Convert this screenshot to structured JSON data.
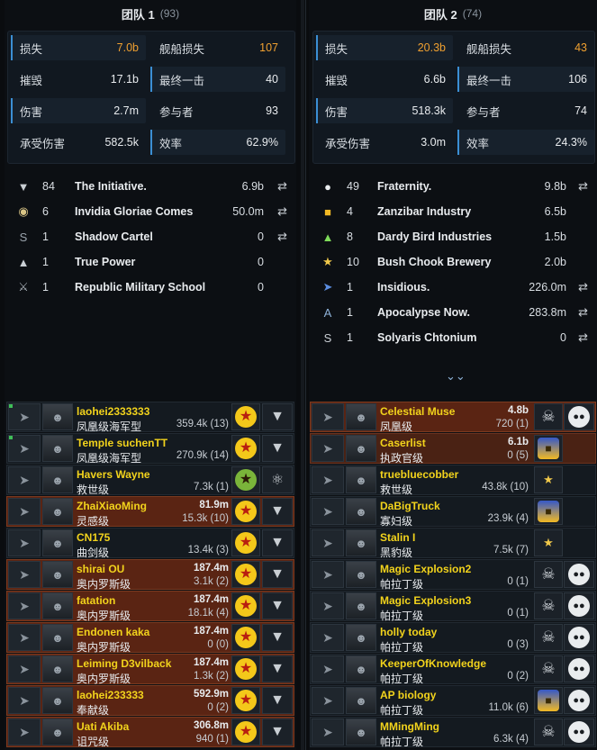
{
  "team1": {
    "name": "团队 1",
    "count": "(93)",
    "stats": [
      {
        "label": "损失",
        "value": "7.0b",
        "orange": true
      },
      {
        "label": "舰船损失",
        "value": "107",
        "orange": true
      },
      {
        "label": "摧毁",
        "value": "17.1b",
        "orange": false
      },
      {
        "label": "最终一击",
        "value": "40",
        "orange": false
      },
      {
        "label": "伤害",
        "value": "2.7m",
        "orange": false
      },
      {
        "label": "参与者",
        "value": "93",
        "orange": false
      },
      {
        "label": "承受伤害",
        "value": "582.5k",
        "orange": false
      },
      {
        "label": "效率",
        "value": "62.9%",
        "orange": false
      }
    ],
    "corps": [
      {
        "num": "84",
        "name": "The Initiative.",
        "amount": "6.9b",
        "share": true,
        "logo": "initiative-logo"
      },
      {
        "num": "6",
        "name": "Invidia Gloriae Comes",
        "amount": "50.0m",
        "share": true,
        "logo": "invidia-logo"
      },
      {
        "num": "1",
        "name": "Shadow Cartel",
        "amount": "0",
        "share": true,
        "logo": "shadow-cartel-logo"
      },
      {
        "num": "1",
        "name": "True Power",
        "amount": "0",
        "share": false,
        "logo": "true-power-logo"
      },
      {
        "num": "1",
        "name": "Republic Military School",
        "amount": "0",
        "share": false,
        "logo": "rms-logo"
      }
    ],
    "pilots": [
      {
        "name": "laohei2333333",
        "ship": "凤凰级海军型",
        "damage": "",
        "dealt": "359.4k (13)",
        "style": "dark",
        "c1": "star",
        "c2": "v",
        "mark": true
      },
      {
        "name": "Temple suchenTT",
        "ship": "凤凰级海军型",
        "damage": "",
        "dealt": "270.9k (14)",
        "style": "dark",
        "c1": "star",
        "c2": "v",
        "mark": true
      },
      {
        "name": "Havers Wayne",
        "ship": "救世级",
        "damage": "",
        "dealt": "7.3k (1)",
        "style": "dark",
        "c1": "star-green",
        "c2": "wings",
        "mark": false
      },
      {
        "name": "ZhaiXiaoMing",
        "ship": "灵感级",
        "damage": "81.9m",
        "dealt": "15.3k (10)",
        "style": "red",
        "c1": "star",
        "c2": "v",
        "mark": false
      },
      {
        "name": "CN175",
        "ship": "曲剑级",
        "damage": "",
        "dealt": "13.4k (3)",
        "style": "dark",
        "c1": "star",
        "c2": "v",
        "mark": false
      },
      {
        "name": "shirai OU",
        "ship": "奥内罗斯级",
        "damage": "187.4m",
        "dealt": "3.1k (2)",
        "style": "red",
        "c1": "star",
        "c2": "v",
        "mark": false
      },
      {
        "name": "fatation",
        "ship": "奥内罗斯级",
        "damage": "187.4m",
        "dealt": "18.1k (4)",
        "style": "red",
        "c1": "star",
        "c2": "v",
        "mark": false
      },
      {
        "name": "Endonen kaka",
        "ship": "奥内罗斯级",
        "damage": "187.4m",
        "dealt": "0 (0)",
        "style": "red",
        "c1": "star",
        "c2": "v",
        "mark": false
      },
      {
        "name": "Leiming D3vilback",
        "ship": "奥内罗斯级",
        "damage": "187.4m",
        "dealt": "1.3k (2)",
        "style": "red",
        "c1": "star",
        "c2": "v",
        "mark": false
      },
      {
        "name": "laohei233333",
        "ship": "奉献级",
        "damage": "592.9m",
        "dealt": "0 (2)",
        "style": "red",
        "c1": "star",
        "c2": "v",
        "mark": false
      },
      {
        "name": "Uati Akiba",
        "ship": "诅咒级",
        "damage": "306.8m",
        "dealt": "940 (1)",
        "style": "red",
        "c1": "star",
        "c2": "v",
        "mark": false
      }
    ]
  },
  "team2": {
    "name": "团队 2",
    "count": "(74)",
    "stats": [
      {
        "label": "损失",
        "value": "20.3b",
        "orange": true
      },
      {
        "label": "舰船损失",
        "value": "43",
        "orange": true
      },
      {
        "label": "摧毁",
        "value": "6.6b",
        "orange": false
      },
      {
        "label": "最终一击",
        "value": "106",
        "orange": false
      },
      {
        "label": "伤害",
        "value": "518.3k",
        "orange": false
      },
      {
        "label": "参与者",
        "value": "74",
        "orange": false
      },
      {
        "label": "承受伤害",
        "value": "3.0m",
        "orange": false
      },
      {
        "label": "效率",
        "value": "24.3%",
        "orange": false
      }
    ],
    "corps": [
      {
        "num": "49",
        "name": "Fraternity.",
        "amount": "9.8b",
        "share": true,
        "logo": "fraternity-logo"
      },
      {
        "num": "4",
        "name": "Zanzibar Industry",
        "amount": "6.5b",
        "share": false,
        "logo": "zanzibar-logo"
      },
      {
        "num": "8",
        "name": "Dardy Bird Industries",
        "amount": "1.5b",
        "share": false,
        "logo": "dardy-bird-logo"
      },
      {
        "num": "10",
        "name": "Bush Chook Brewery",
        "amount": "2.0b",
        "share": false,
        "logo": "bush-chook-logo"
      },
      {
        "num": "1",
        "name": "Insidious.",
        "amount": "226.0m",
        "share": true,
        "logo": "insidious-logo"
      },
      {
        "num": "1",
        "name": "Apocalypse Now.",
        "amount": "283.8m",
        "share": true,
        "logo": "apocalypse-logo"
      },
      {
        "num": "1",
        "name": "Solyaris Chtonium",
        "amount": "0",
        "share": true,
        "logo": "solyaris-logo"
      }
    ],
    "pilots": [
      {
        "name": "Celestial Muse",
        "ship": "凤凰级",
        "damage": "4.8b",
        "dealt": "720 (1)",
        "style": "red",
        "c1": "skull",
        "c2": "panda"
      },
      {
        "name": "Caserlist",
        "ship": "执政官级",
        "damage": "6.1b",
        "dealt": "0 (5)",
        "style": "redlight",
        "c1": "gold",
        "c2": ""
      },
      {
        "name": "truebluecobber",
        "ship": "救世级",
        "damage": "",
        "dealt": "43.8k (10)",
        "style": "dark",
        "c1": "smallstar",
        "c2": ""
      },
      {
        "name": "DaBigTruck",
        "ship": "寡妇级",
        "damage": "",
        "dealt": "23.9k (4)",
        "style": "dark",
        "c1": "gold",
        "c2": ""
      },
      {
        "name": "Stalin I",
        "ship": "黑豹级",
        "damage": "",
        "dealt": "7.5k (7)",
        "style": "dark",
        "c1": "smallstar",
        "c2": ""
      },
      {
        "name": "Magic Explosion2",
        "ship": "帕拉丁级",
        "damage": "",
        "dealt": "0 (1)",
        "style": "dark",
        "c1": "skull",
        "c2": "panda"
      },
      {
        "name": "Magic Explosion3",
        "ship": "帕拉丁级",
        "damage": "",
        "dealt": "0 (1)",
        "style": "dark",
        "c1": "skull",
        "c2": "panda"
      },
      {
        "name": "holly today",
        "ship": "帕拉丁级",
        "damage": "",
        "dealt": "0 (3)",
        "style": "dark",
        "c1": "skull",
        "c2": "panda"
      },
      {
        "name": "KeeperOfKnowledge",
        "ship": "帕拉丁级",
        "damage": "",
        "dealt": "0 (2)",
        "style": "dark",
        "c1": "skull",
        "c2": "panda"
      },
      {
        "name": "AP biology",
        "ship": "帕拉丁级",
        "damage": "",
        "dealt": "11.0k (6)",
        "style": "dark",
        "c1": "gold",
        "c2": "panda"
      },
      {
        "name": "MMingMing",
        "ship": "帕拉丁级",
        "damage": "",
        "dealt": "6.3k (4)",
        "style": "dark",
        "c1": "skull",
        "c2": "panda"
      }
    ]
  },
  "colors": {
    "accent_orange": "#f0a030",
    "pilot_name": "#f2d31c",
    "highlight_bar": "#3b8fd4"
  }
}
